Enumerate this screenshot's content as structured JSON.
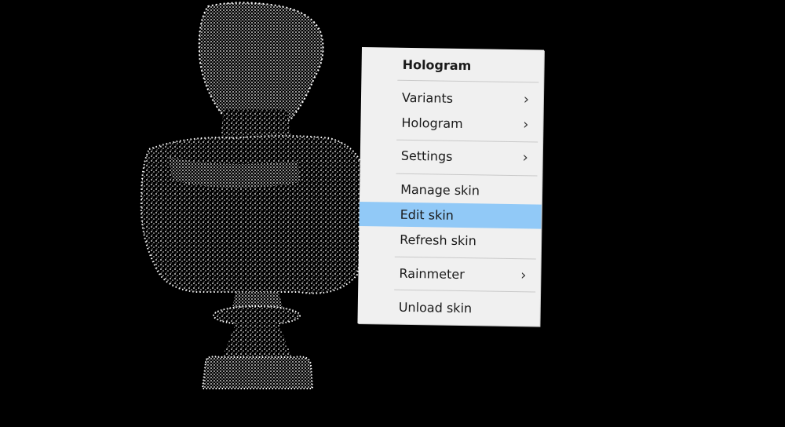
{
  "desktop": {
    "background_color": "#000000",
    "hologram_image": "point-cloud-bust"
  },
  "menu": {
    "title": "Hologram",
    "items": [
      {
        "label": "Variants",
        "submenu": true
      },
      {
        "label": "Hologram",
        "submenu": true
      },
      {
        "label": "Settings",
        "submenu": true
      },
      {
        "label": "Manage skin",
        "submenu": false
      },
      {
        "label": "Edit skin",
        "submenu": false,
        "highlighted": true
      },
      {
        "label": "Refresh skin",
        "submenu": false
      },
      {
        "label": "Rainmeter",
        "submenu": true
      },
      {
        "label": "Unload skin",
        "submenu": false
      }
    ],
    "submenu_glyph": "›",
    "highlight_color": "#91c9f7",
    "background_color": "#f0f0f0"
  }
}
